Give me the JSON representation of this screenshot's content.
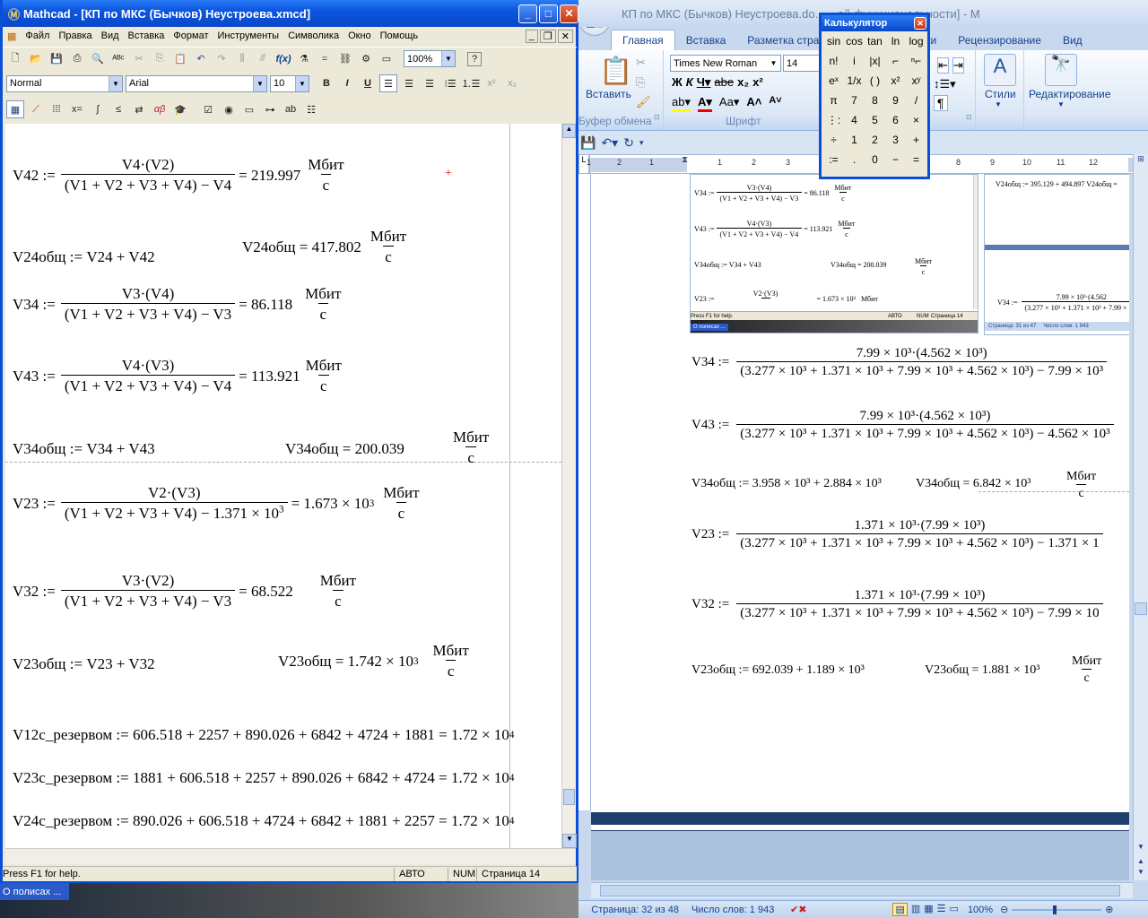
{
  "mathcad": {
    "title": "Mathcad - [КП по МКС (Бычков) Неустроева.xmcd]",
    "menu": [
      "Файл",
      "Правка",
      "Вид",
      "Вставка",
      "Формат",
      "Инструменты",
      "Символика",
      "Окно",
      "Помощь"
    ],
    "zoom": "100%",
    "style": "Normal",
    "font": "Arial",
    "font_size": "10",
    "equations": [
      {
        "lhs": "V42 :=",
        "num": "V4·(V2)",
        "den": "(V1 + V2 + V3 + V4) − V4",
        "res": "= 219.997",
        "unit_n": "Мбит",
        "unit_d": "с"
      },
      {
        "def": "V24общ := V24 + V42",
        "eval": "V24общ = 417.802",
        "unit_n": "Мбит",
        "unit_d": "с"
      },
      {
        "lhs": "V34 :=",
        "num": "V3·(V4)",
        "den": "(V1 + V2 + V3 + V4) − V3",
        "res": "= 86.118",
        "unit_n": "Мбит",
        "unit_d": "с"
      },
      {
        "lhs": "V43 :=",
        "num": "V4·(V3)",
        "den": "(V1 + V2 + V3 + V4) − V4",
        "res": "= 113.921",
        "unit_n": "Мбит",
        "unit_d": "с"
      },
      {
        "def": "V34общ := V34 + V43",
        "eval": "V34общ = 200.039",
        "unit_n": "Мбит",
        "unit_d": "с"
      },
      {
        "lhs": "V23 :=",
        "num": "V2·(V3)",
        "den": "(V1 + V2 + V3 + V4) − 1.371 × 10",
        "den_exp": "3",
        "res": "= 1.673 × 10",
        "res_exp": "3",
        "unit_n": "Мбит",
        "unit_d": "с"
      },
      {
        "lhs": "V32 :=",
        "num": "V3·(V2)",
        "den": "(V1 + V2 + V3 + V4) − V3",
        "res": "= 68.522",
        "unit_n": "Мбит",
        "unit_d": "с"
      },
      {
        "def": "V23общ := V23 + V32",
        "eval": "V23общ = 1.742 × 10",
        "eval_exp": "3",
        "unit_n": "Мбит",
        "unit_d": "с"
      },
      {
        "line": "V12с_резервом := 606.518 + 2257 + 890.026 + 6842 + 4724 + 1881 = 1.72 × 10",
        "exp": "4"
      },
      {
        "line": "V23с_резервом := 1881 + 606.518 + 2257 + 890.026 + 6842 + 4724 = 1.72 × 10",
        "exp": "4"
      },
      {
        "line": "V24с_резервом := 890.026 + 606.518 + 4724 + 6842 + 1881 + 2257 = 1.72 × 10",
        "exp": "4"
      }
    ],
    "status": {
      "help": "Press F1 for help.",
      "mode": "АВТО",
      "num": "NUM",
      "page": "Страница 14"
    }
  },
  "word": {
    "title": "КП по МКС (Бычков) Неустроева.do... ...ой функциональности] - М",
    "tabs": [
      "Главная",
      "Вставка",
      "Разметка страни",
      "...ссылки",
      "Рецензирование",
      "Вид"
    ],
    "font": "Times New Roman",
    "font_size": "14",
    "groups": {
      "clipboard": "Буфер обмена",
      "font": "Шрифт",
      "paste": "Вставить",
      "styles": "Стили",
      "edit": "Редактирование"
    },
    "ruler": [
      "1",
      "2",
      "1",
      "1",
      "2",
      "3",
      "4",
      "5",
      "6",
      "7",
      "8",
      "9",
      "10",
      "11",
      "12"
    ],
    "equations": {
      "v34_lhs": "V34 :=",
      "v34_num": "7.99 × 10³·(4.562 × 10³)",
      "v34_den": "(3.277 × 10³ + 1.371 × 10³ + 7.99 × 10³ + 4.562 × 10³) − 7.99 × 10³",
      "v43_lhs": "V43 :=",
      "v43_num": "7.99 × 10³·(4.562 × 10³)",
      "v43_den": "(3.277 × 10³ + 1.371 × 10³ + 7.99 × 10³ + 4.562 × 10³) − 4.562 × 10³",
      "v34sum_def": "V34общ := 3.958 × 10³ + 2.884 × 10³",
      "v34sum_eval": "V34общ = 6.842 × 10³",
      "v23_lhs": "V23 :=",
      "v23_num": "1.371 × 10³·(7.99 × 10³)",
      "v23_den": "(3.277 × 10³ + 1.371 × 10³ + 7.99 × 10³ + 4.562 × 10³) − 1.371 × 1",
      "v32_lhs": "V32 :=",
      "v32_num": "1.371 × 10³·(7.99 × 10³)",
      "v32_den": "(3.277 × 10³ + 1.371 × 10³ + 7.99 × 10³ + 4.562 × 10³) − 7.99 × 10",
      "v23sum_def": "V23общ := 692.039 + 1.189 × 10³",
      "v23sum_eval": "V23общ = 1.881 × 10³",
      "unit_n": "Мбит",
      "unit_d": "с"
    },
    "thumb": {
      "v34": "V34 :=",
      "v34_num": "V3·(V4)",
      "v34_den": "(V1 + V2 + V3 + V4) − V3",
      "v34_res": "= 86.118",
      "v43": "V43 :=",
      "v43_num": "V4·(V3)",
      "v43_den": "(V1 + V2 + V3 + V4) − V4",
      "v43_res": "= 113.921",
      "v34sum_def": "V34общ := V34 + V43",
      "v34sum_eval": "V34общ = 200.039",
      "v23": "V23 :=",
      "v23_num": "V2·(V3)",
      "v23_res": "= 1.673 × 10³",
      "help": "Press F1 for help.",
      "mode": "АВТО",
      "num": "NUM",
      "page": "Страница 14",
      "task": "О полисах ...",
      "right_top": "V24общ := 395.129 + 494.897    V24общ =",
      "right_status_page": "Страница: 31 из 47",
      "right_status_words": "Число слов: 1 943",
      "right_v34": "V34 :=",
      "right_v34_num": "7.99 × 10³·(4.562",
      "right_v34_den": "(3.277 × 10³ + 1.371 × 10³ + 7.99 × 10³"
    },
    "status": {
      "page": "Страница: 32 из 48",
      "words": "Число слов: 1 943",
      "zoom": "100%"
    }
  },
  "calculator": {
    "title": "Калькулятор",
    "keys": [
      "sin",
      "cos",
      "tan",
      "ln",
      "log",
      "n!",
      "i",
      "|x|",
      "⌐",
      "ⁿ⌐",
      "eˣ",
      "1/x",
      "( )",
      "x²",
      "xʸ",
      "π",
      "7",
      "8",
      "9",
      "/",
      "⋮:",
      "4",
      "5",
      "6",
      "×",
      "÷",
      "1",
      "2",
      "3",
      "+",
      ":=",
      ".",
      "0",
      "−",
      "="
    ]
  },
  "taskbar": {
    "item": "О полисах ..."
  }
}
